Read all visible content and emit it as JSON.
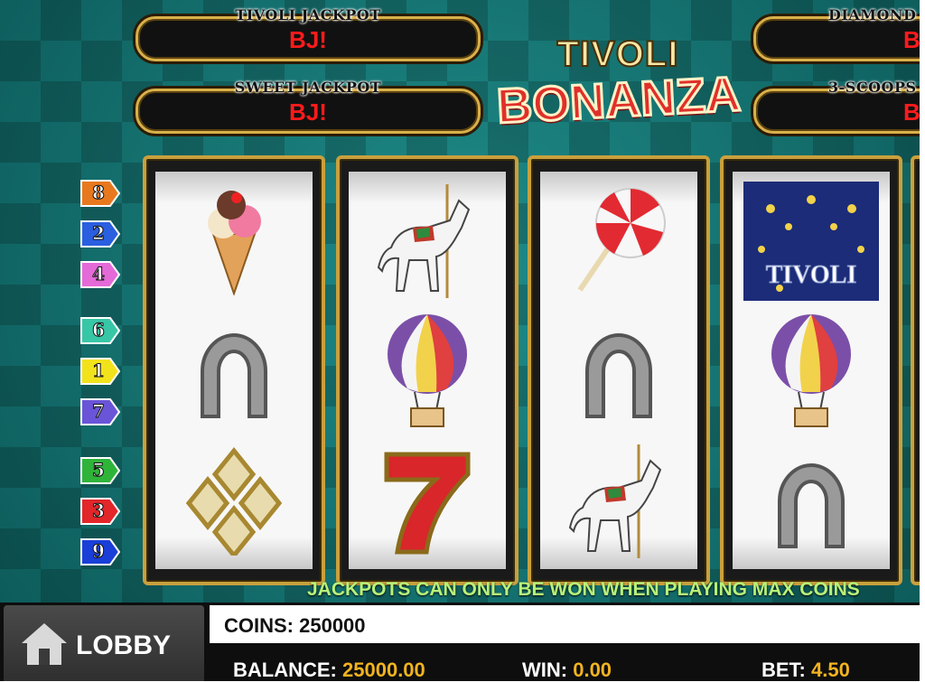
{
  "jackpots": {
    "tivoli": {
      "label": "TIVOLI JACKPOT",
      "value": "BJ!"
    },
    "sweet": {
      "label": "SWEET JACKPOT",
      "value": "BJ!"
    },
    "diamond": {
      "label": "DIAMOND",
      "value": "B"
    },
    "scoops": {
      "label": "3-SCOOPS",
      "value": "B"
    }
  },
  "logo": {
    "line1": "TIVOLI",
    "line2": "BONANZA"
  },
  "reels": [
    [
      "ice-cream",
      "horseshoe",
      "diamonds"
    ],
    [
      "carousel-horse",
      "hot-air-balloon",
      "seven"
    ],
    [
      "lollipop",
      "horseshoe",
      "carousel-horse"
    ],
    [
      "tivoli-fireworks",
      "hot-air-balloon",
      "horseshoe"
    ]
  ],
  "tivoli_symbol_text": "TIVOLI",
  "paylines": [
    {
      "number": "8",
      "color": "#e8781e"
    },
    {
      "number": "2",
      "color": "#2a5fe0"
    },
    {
      "number": "4",
      "color": "#e46ad8"
    },
    {
      "number": "6",
      "color": "#38c7a6"
    },
    {
      "number": "1",
      "color": "#f2e21c"
    },
    {
      "number": "7",
      "color": "#6a55d8"
    },
    {
      "number": "5",
      "color": "#2fb43a"
    },
    {
      "number": "3",
      "color": "#e2262a"
    },
    {
      "number": "9",
      "color": "#1a3fd8"
    }
  ],
  "notice": "JACKPOTS CAN ONLY BE WON WHEN PLAYING MAX COINS",
  "lobby": {
    "label": "LOBBY"
  },
  "coins": "COINS: 250000",
  "balance": {
    "label": "BALANCE:",
    "value": "25000.00"
  },
  "win": {
    "label": "WIN:",
    "value": "0.00"
  },
  "bet": {
    "label": "BET:",
    "value": "4.50"
  }
}
